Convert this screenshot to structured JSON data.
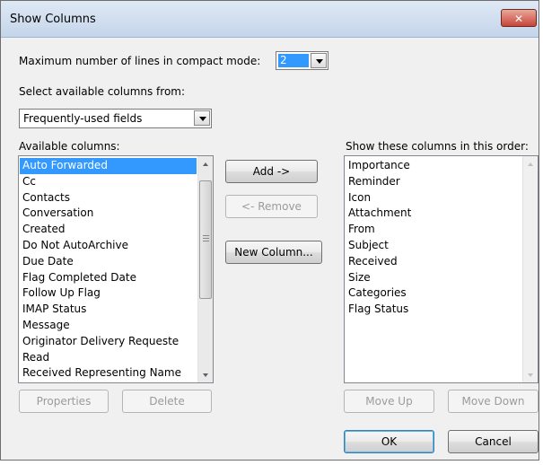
{
  "dialog": {
    "title": "Show Columns",
    "close_symbol": "✕"
  },
  "compact": {
    "label": "Maximum number of lines in compact mode:",
    "value": "2"
  },
  "select_from": {
    "label": "Select available columns from:",
    "value": "Frequently-used fields"
  },
  "available": {
    "label": "Available columns:",
    "items": [
      "Auto Forwarded",
      "Cc",
      "Contacts",
      "Conversation",
      "Created",
      "Do Not AutoArchive",
      "Due Date",
      "Flag Completed Date",
      "Follow Up Flag",
      "IMAP Status",
      "Message",
      "Originator Delivery Requeste",
      "Read",
      "Received Representing Name"
    ],
    "selected_index": 0
  },
  "shown": {
    "label": "Show these columns in this order:",
    "items": [
      "Importance",
      "Reminder",
      "Icon",
      "Attachment",
      "From",
      "Subject",
      "Received",
      "Size",
      "Categories",
      "Flag Status"
    ]
  },
  "buttons": {
    "add": "Add ->",
    "remove": "<- Remove",
    "new_column": "New Column...",
    "properties": "Properties",
    "delete": "Delete",
    "move_up": "Move Up",
    "move_down": "Move Down",
    "ok": "OK",
    "cancel": "Cancel"
  },
  "colors": {
    "selection": "#3399ff",
    "title_bar": "#c4d5ea",
    "close_button": "#c7443a"
  }
}
